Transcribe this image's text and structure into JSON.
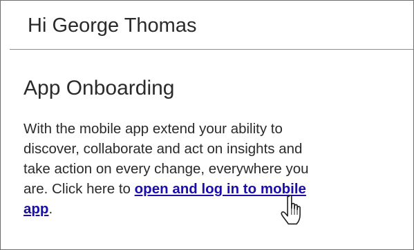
{
  "header": {
    "greeting": "Hi George Thomas"
  },
  "section": {
    "title": "App Onboarding",
    "body_line_1": "With the mobile app extend your ability to",
    "body_line_2": "discover, collaborate and act on insights and",
    "body_line_3": "take action on every change, everywhere you",
    "body_line_4_prefix": "are. Click here to ",
    "link_part_1": "open and log in to mobile",
    "link_part_2": "app",
    "trailing_period": "."
  },
  "icons": {
    "cursor": "hand-pointer-icon"
  },
  "colors": {
    "link": "#1a0dab",
    "text": "#2a2a2a",
    "divider": "#8c8c8c"
  }
}
